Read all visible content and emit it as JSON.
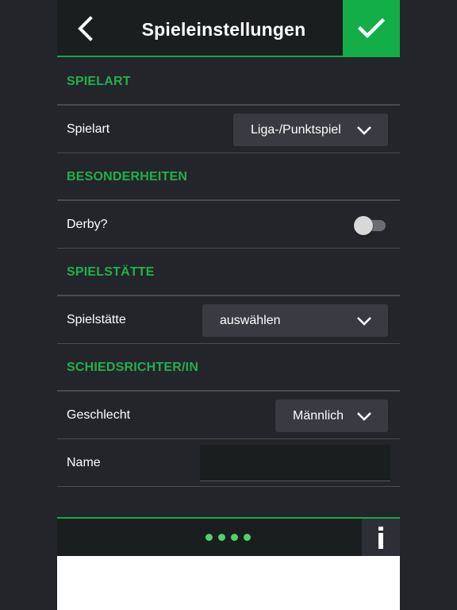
{
  "header": {
    "title": "Spieleinstellungen",
    "back_icon": "chevron-left-icon",
    "confirm_icon": "checkmark-icon",
    "accent_color": "#13ae48"
  },
  "sections": {
    "spielart": {
      "heading": "SPIELART",
      "row_label": "Spielart",
      "select_value": "Liga-/Punktspiel"
    },
    "besonderheiten": {
      "heading": "BESONDERHEITEN",
      "row_label": "Derby?",
      "toggle_on": false
    },
    "spielstaette": {
      "heading": "SPIELSTÄTTE",
      "row_label": "Spielstätte",
      "select_value": "auswählen"
    },
    "schiedsrichter": {
      "heading": "SCHIEDSRICHTER/IN",
      "gender_label": "Geschlecht",
      "gender_value": "Männlich",
      "name_label": "Name",
      "name_value": ""
    }
  },
  "footer": {
    "page_dots": 4,
    "info_label": "i"
  }
}
